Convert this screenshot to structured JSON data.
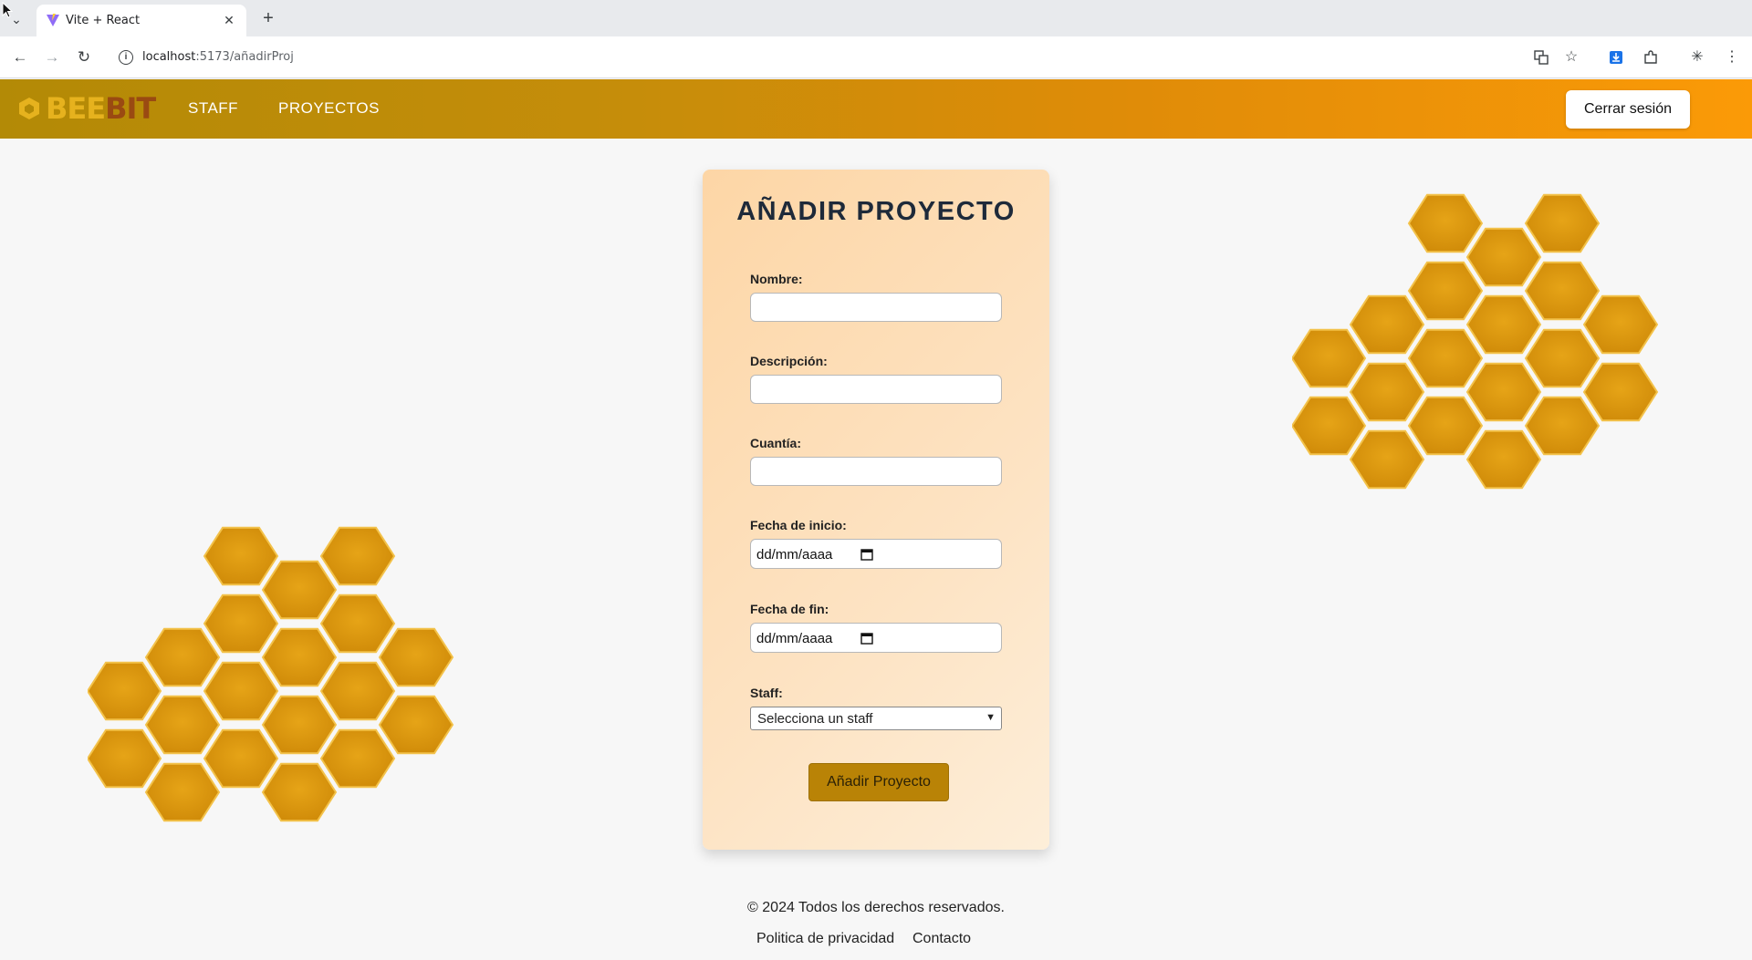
{
  "browser": {
    "tab_title": "Vite + React",
    "url_host": "localhost",
    "url_path": ":5173/añadirProj"
  },
  "navbar": {
    "logo_part1": "BEE",
    "logo_part2": "BIT",
    "links": [
      {
        "label": "STAFF"
      },
      {
        "label": "PROYECTOS"
      }
    ],
    "logout_label": "Cerrar sesión"
  },
  "form": {
    "title": "AÑADIR PROYECTO",
    "fields": {
      "nombre": {
        "label": "Nombre:",
        "value": ""
      },
      "descripcion": {
        "label": "Descripción:",
        "value": ""
      },
      "cuantia": {
        "label": "Cuantía:",
        "value": ""
      },
      "fecha_inicio": {
        "label": "Fecha de inicio:",
        "value": "dd/mm/aaaa"
      },
      "fecha_fin": {
        "label": "Fecha de fin:",
        "value": "dd/mm/aaaa"
      },
      "staff": {
        "label": "Staff:",
        "selected": "Selecciona un staff"
      }
    },
    "submit_label": "Añadir Proyecto"
  },
  "footer": {
    "copyright": "© 2024 Todos los derechos reservados.",
    "privacy": "Politica de privacidad",
    "contact": "Contacto"
  },
  "colors": {
    "navbar_start": "#b38a06",
    "navbar_end": "#fb9a07",
    "hex_fill": "#dc980e",
    "button_accent": "#b98306",
    "title_text": "#1e2a3a"
  }
}
